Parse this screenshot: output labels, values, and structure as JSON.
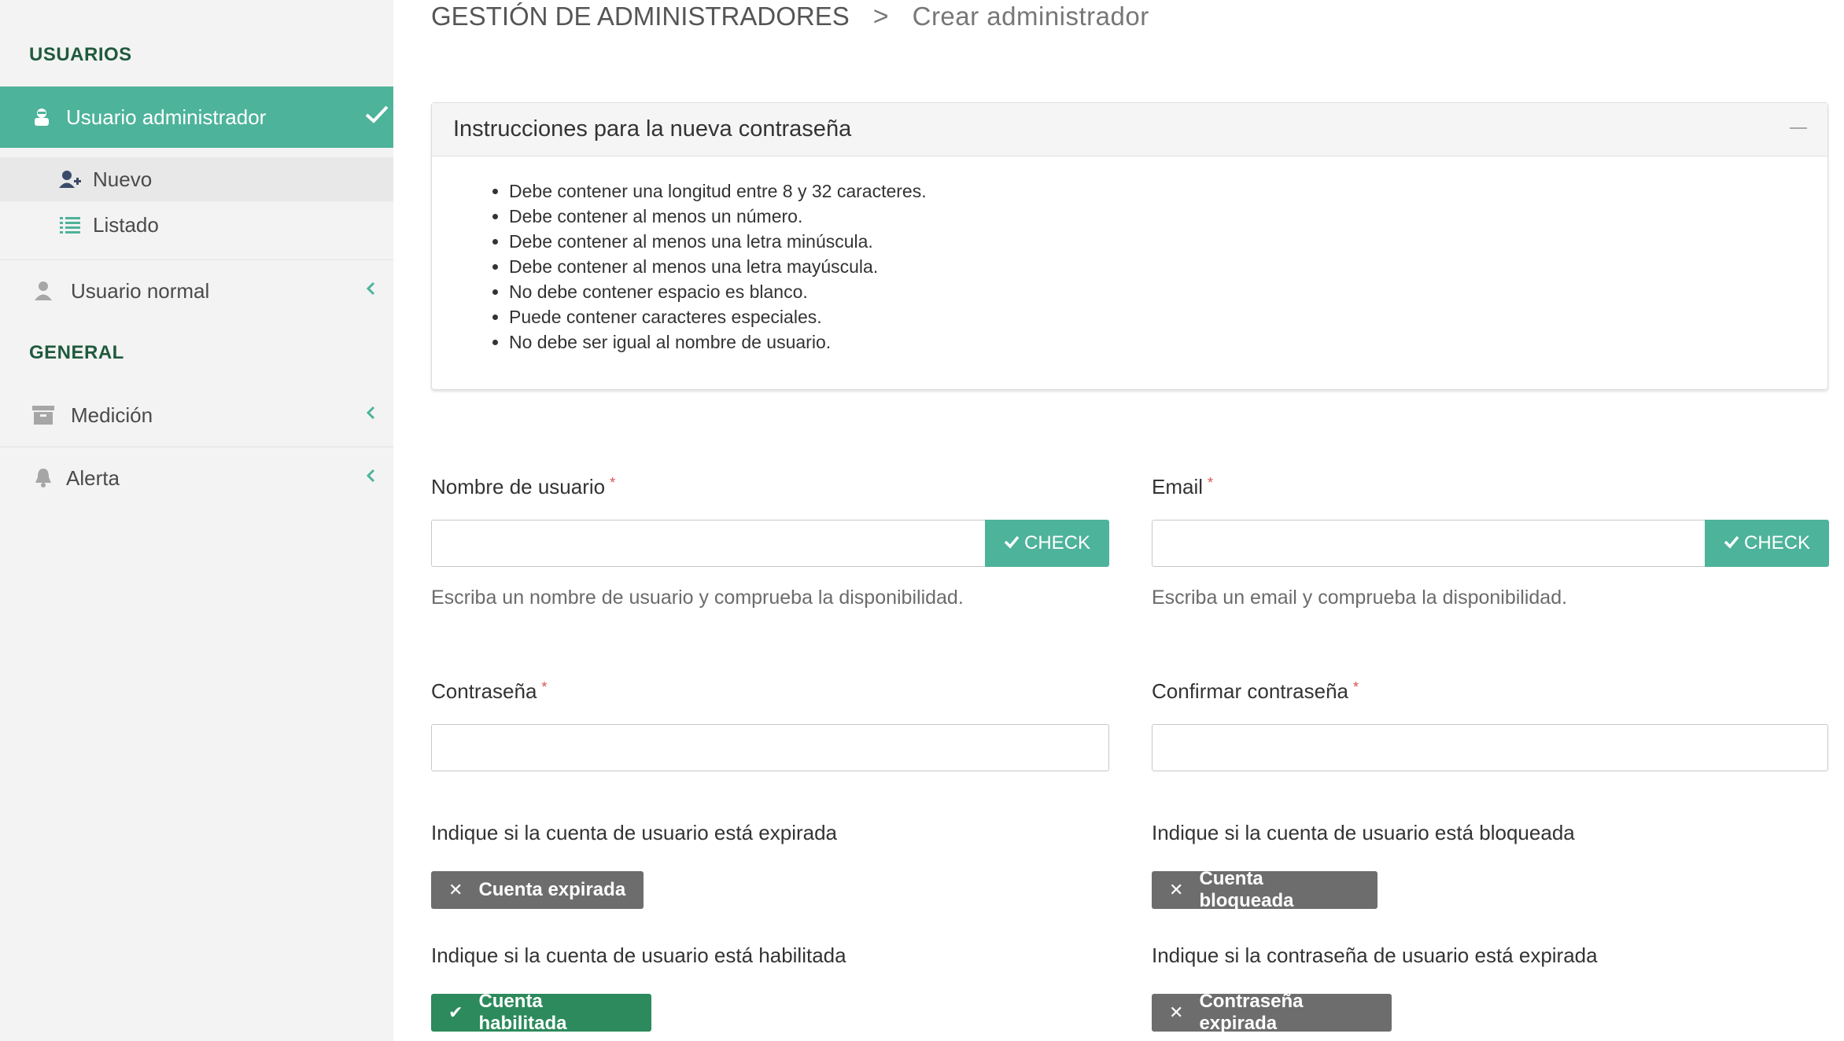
{
  "sidebar": {
    "section_usuarios": "USUARIOS",
    "active_item": "Usuario administrador",
    "sub_items": [
      {
        "label": "Nuevo",
        "icon": "user-plus-icon"
      },
      {
        "label": "Listado",
        "icon": "list-icon"
      }
    ],
    "usuario_normal": "Usuario normal",
    "section_general": "GENERAL",
    "medicion": "Medición",
    "alerta": "Alerta"
  },
  "breadcrumb": {
    "root": "GESTIÓN DE ADMINISTRADORES",
    "separator": ">",
    "current": "Crear administrador"
  },
  "instructions": {
    "title": "Instrucciones para la nueva contraseña",
    "items": [
      "Debe contener una longitud entre 8 y 32 caracteres.",
      "Debe contener al menos un número.",
      "Debe contener al menos una letra minúscula.",
      "Debe contener al menos una letra mayúscula.",
      "No debe contener espacio es blanco.",
      "Puede contener caracteres especiales.",
      "No debe ser igual al nombre de usuario."
    ]
  },
  "form": {
    "username_label": "Nombre de usuario",
    "username_value": "",
    "username_help": "Escriba un nombre de usuario y comprueba la disponibilidad.",
    "email_label": "Email",
    "email_value": "",
    "email_help": "Escriba un email y comprueba la disponibilidad.",
    "check_label": "CHECK",
    "required_mark": "*",
    "password_label": "Contraseña",
    "confirm_label": "Confirmar contraseña",
    "expired_question": "Indique si la cuenta de usuario está expirada",
    "expired_toggle": "Cuenta expirada",
    "locked_question": "Indique si la cuenta de usuario está bloqueada",
    "locked_toggle": "Cuenta bloqueada",
    "enabled_question": "Indique si la cuenta de usuario está habilitada",
    "enabled_toggle": "Cuenta habilitada",
    "pwexpired_question": "Indique si la contraseña de usuario está expirada",
    "pwexpired_toggle": "Contraseña expirada"
  },
  "colors": {
    "accent": "#4db39a",
    "enabled": "#2c8a5c",
    "disabled": "#6d6d6d",
    "section_text": "#1f5a3d"
  }
}
